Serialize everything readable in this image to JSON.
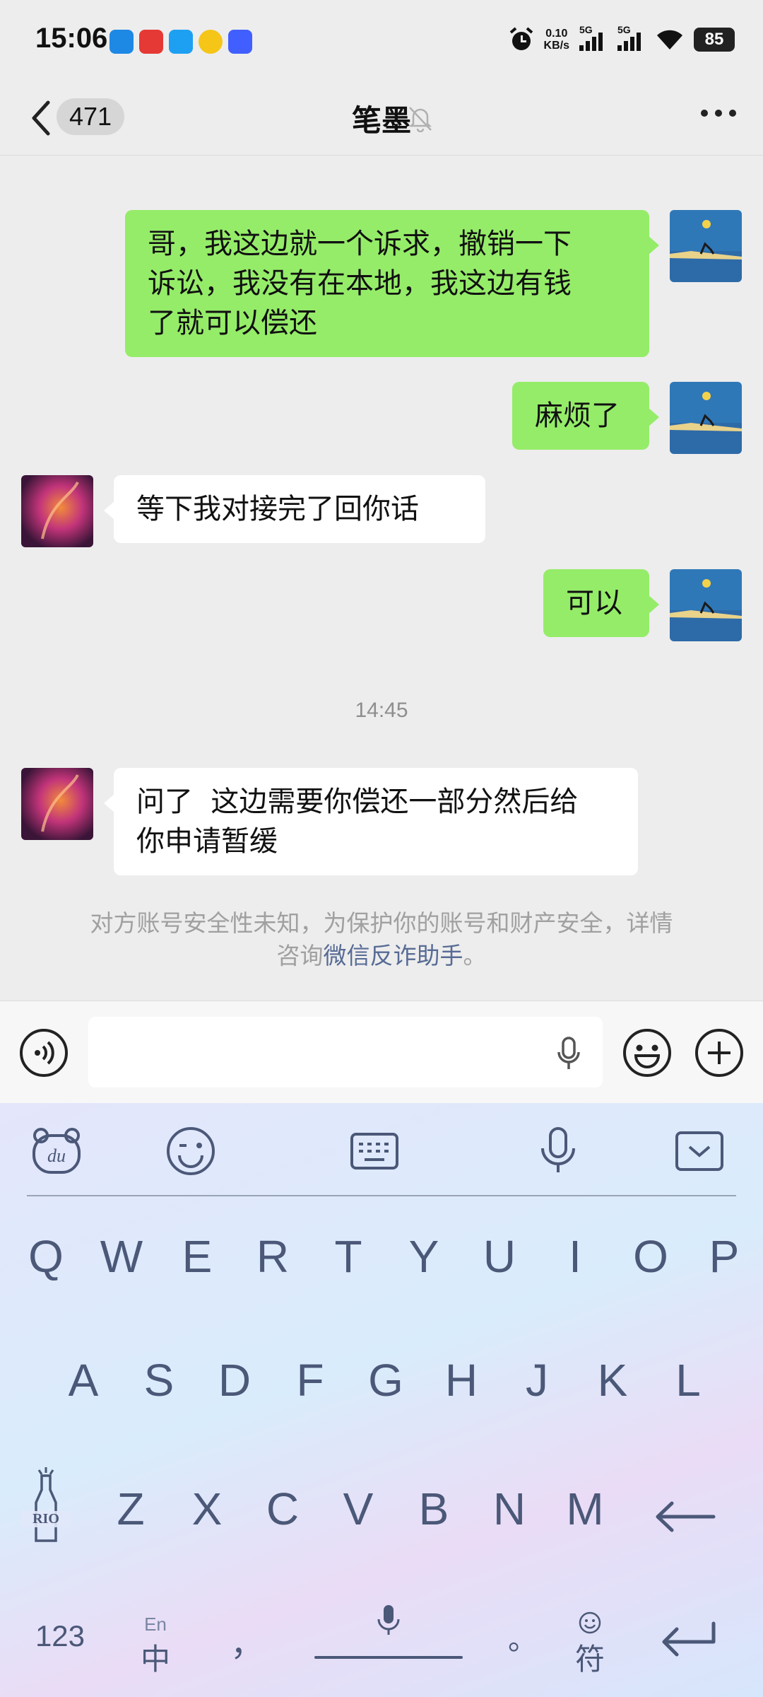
{
  "status_bar": {
    "time": "15:06",
    "speed_value": "0.10",
    "speed_unit": "KB/s",
    "sim1_label": "5G",
    "sim2_label": "5G",
    "battery": "85",
    "app_icons": [
      "notification-icon",
      "app-icon-red",
      "app-icon-blue",
      "app-icon-yellow",
      "vivo-icon"
    ]
  },
  "header": {
    "back_icon": "chevron-left-icon",
    "unread_count": "471",
    "title": "笔墨",
    "mute_icon": "bell-muted-icon",
    "more_icon": "more-dots-icon"
  },
  "messages": [
    {
      "side": "sent",
      "text_lines": [
        "哥，我这边就一个诉求，撤销一下",
        "诉讼，我没有在本地，我这边有钱",
        "了就可以偿还"
      ]
    },
    {
      "side": "sent",
      "text_lines": [
        "麻烦了"
      ]
    },
    {
      "side": "received",
      "text_lines": [
        "等下我对接完了回你话"
      ]
    },
    {
      "side": "sent",
      "text_lines": [
        "可以"
      ]
    },
    {
      "side": "received",
      "text_lines": [
        "问了  这边需要你偿还一部分然后给",
        "你申请暂缓"
      ]
    }
  ],
  "timestamp": "14:45",
  "notice": {
    "line1": "对方账号安全性未知，为保护你的账号和财产安全，详情",
    "line2_prefix": "咨询",
    "link": "微信反诈助手",
    "line2_suffix": "。"
  },
  "input_bar": {
    "voice_icon": "voice-mode-icon",
    "mic_icon": "microphone-icon",
    "emoji_icon": "emoji-icon",
    "plus_icon": "plus-icon",
    "text_value": ""
  },
  "keyboard": {
    "toolbar_icons": [
      "baidu-bear-icon",
      "wink-emoji-icon",
      "keyboard-icon",
      "microphone-icon",
      "collapse-keyboard-icon"
    ],
    "row1": [
      "Q",
      "W",
      "E",
      "R",
      "T",
      "Y",
      "U",
      "I",
      "O",
      "P"
    ],
    "row2": [
      "A",
      "S",
      "D",
      "F",
      "G",
      "H",
      "J",
      "K",
      "L"
    ],
    "row3": [
      "Z",
      "X",
      "C",
      "V",
      "B",
      "N",
      "M"
    ],
    "rio_label": "RIO",
    "backspace_icon": "backspace-arrow-icon",
    "num_key": "123",
    "lang_top": "En",
    "lang_main": "中",
    "comma": "，",
    "period": "。",
    "symbol_key": "符",
    "enter_icon": "enter-return-icon"
  }
}
